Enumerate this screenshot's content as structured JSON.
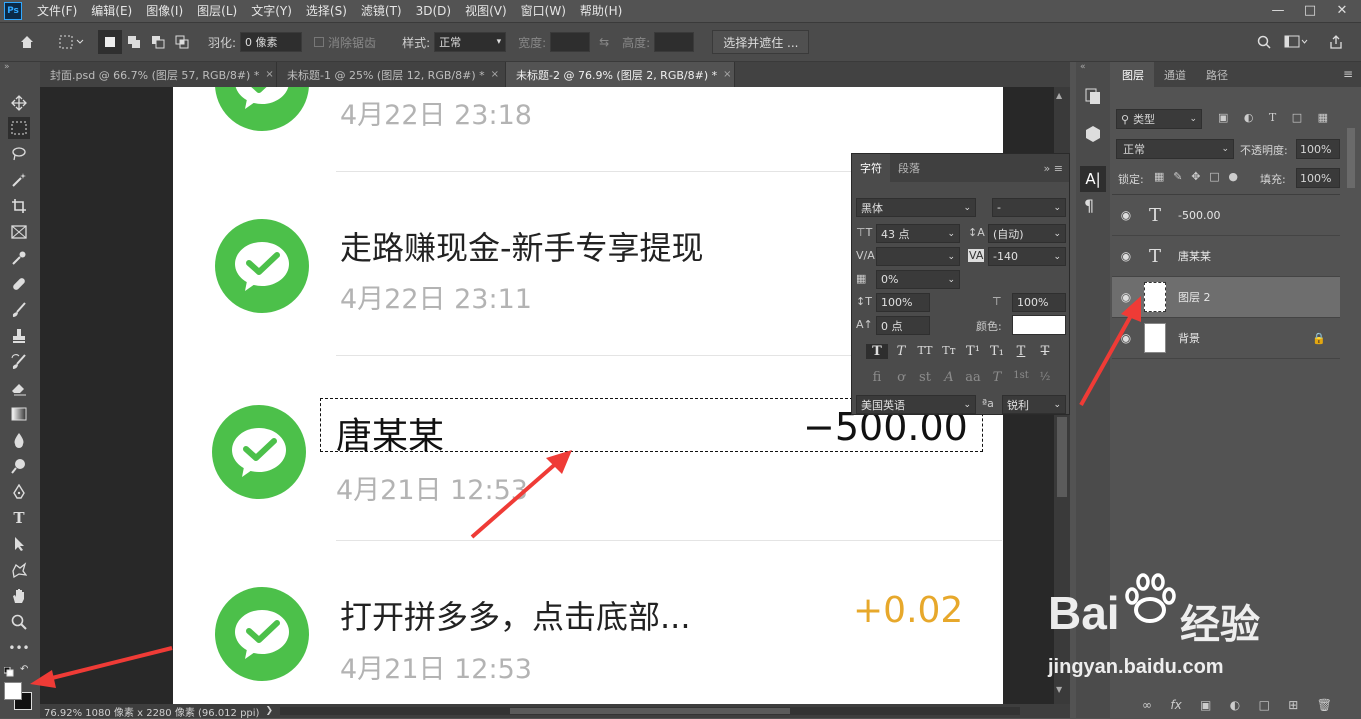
{
  "menubar": {
    "logo": "Ps",
    "items": [
      "文件(F)",
      "编辑(E)",
      "图像(I)",
      "图层(L)",
      "文字(Y)",
      "选择(S)",
      "滤镜(T)",
      "3D(D)",
      "视图(V)",
      "窗口(W)",
      "帮助(H)"
    ]
  },
  "options": {
    "feather_label": "羽化:",
    "feather_value": "0 像素",
    "antialias_label": "消除锯齿",
    "style_label": "样式:",
    "style_value": "正常",
    "width_label": "宽度:",
    "height_label": "高度:",
    "select_mask_button": "选择并遮住 ..."
  },
  "tabs": [
    {
      "label": "封面.psd @ 66.7% (图层 57, RGB/8#) *",
      "close": "×"
    },
    {
      "label": "未标题-1 @ 25% (图层 12, RGB/8#) *",
      "close": "×"
    },
    {
      "label": "未标题-2 @ 76.9% (图层 2, RGB/8#) *",
      "close": "×"
    }
  ],
  "document": {
    "rows": [
      {
        "title": "",
        "date": "4月22日 23:18",
        "amount": ""
      },
      {
        "title": "走路赚现金-新手专享提现",
        "date": "4月22日 23:11",
        "amount": ""
      },
      {
        "title": "唐某某",
        "date": "4月21日 12:53",
        "amount": "−500.00"
      },
      {
        "title": "打开拼多多，点击底部...",
        "date": "4月21日 12:53",
        "amount": "+0.02"
      }
    ],
    "amount_positive_color": "#e7a82b"
  },
  "character_panel": {
    "tab_char": "字符",
    "tab_para": "段落",
    "font_family": "黑体",
    "font_style": "-",
    "font_size": "43 点",
    "leading": "(自动)",
    "kerning": "",
    "tracking": "-140",
    "scale_pct": "0%",
    "vscale": "100%",
    "hscale": "100%",
    "baseline": "0 点",
    "color_label": "颜色:",
    "language": "美国英语",
    "aa_label": "ªa",
    "antialias": "锐利"
  },
  "layers_panel": {
    "tabs": [
      "图层",
      "通道",
      "路径"
    ],
    "filter_kind": "类型",
    "blend_mode": "正常",
    "opacity_label": "不透明度:",
    "opacity": "100%",
    "lock_label": "锁定:",
    "fill_label": "填充:",
    "fill": "100%",
    "layers": [
      {
        "name": "-500.00",
        "type": "text"
      },
      {
        "name": "唐某某",
        "type": "text"
      },
      {
        "name": "图层 2",
        "type": "pixel",
        "selected": true
      },
      {
        "name": "背景",
        "type": "background",
        "locked": true
      }
    ]
  },
  "status": {
    "text": "76.92%  1080 像素 x 2280 像素 (96.012 ppi)"
  },
  "watermark": {
    "brand": "Bai",
    "brand2": "经验",
    "url": "jingyan.baidu.com"
  }
}
